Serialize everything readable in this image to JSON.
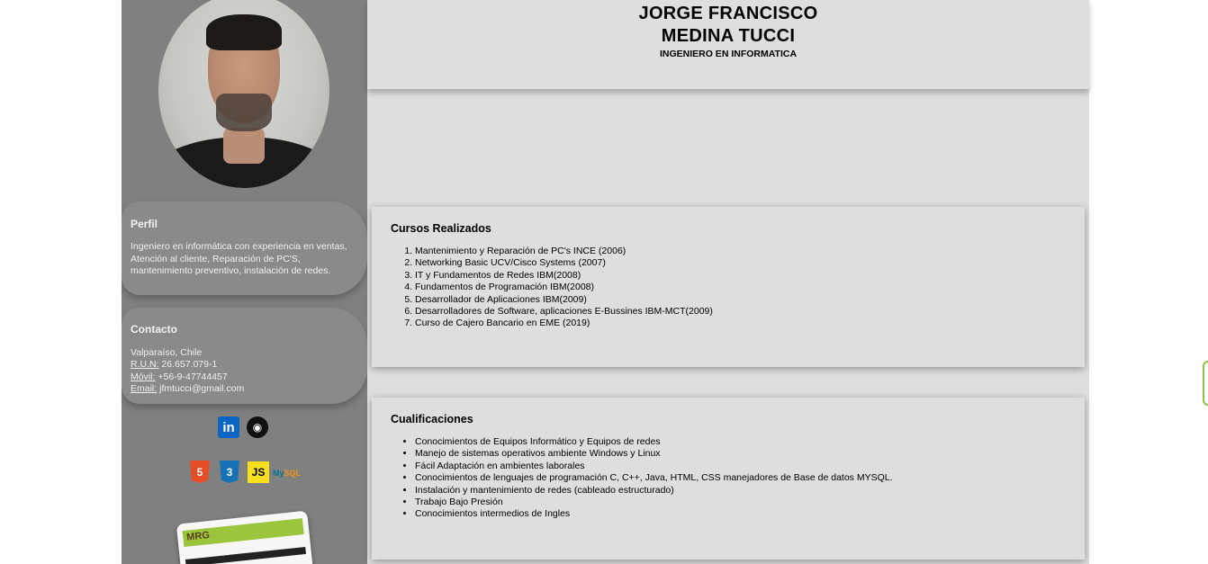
{
  "header": {
    "name_line1": "JORGE FRANCISCO",
    "name_line2": "MEDINA TUCCI",
    "role": "INGENIERO EN INFORMATICA"
  },
  "sidebar": {
    "perfil": {
      "title": "Perfil",
      "text": "Ingeniero en informática con experiencia en ventas, Atención al cliente, Reparación de PC'S, mantenimiento preventivo, instalación de redes."
    },
    "contacto": {
      "title": "Contacto",
      "location": "Valparaíso, Chile",
      "run_label": "R.U.N:",
      "run_value": "26.657.079-1",
      "movil_label": "Móvil:",
      "movil_value": "+56-9-47744457",
      "email_label": "Email:",
      "email_value": "jfmtucci@gmail.com"
    },
    "social": {
      "linkedin_glyph": "in",
      "github_glyph": "◉"
    },
    "tech": {
      "html_glyph": "5",
      "css_glyph": "3",
      "js_glyph": "JS",
      "mysql_my": "My",
      "mysql_sql": "SQL"
    },
    "thumbnail": {
      "logo_text": "MRG"
    }
  },
  "cursos": {
    "title": "Cursos Realizados",
    "items": [
      "Mantenimiento y Reparación de PC's INCE (2006)",
      "Networking Basic UCV/Cisco Systems (2007)",
      "IT y Fundamentos de Redes IBM(2008)",
      "Fundamentos de Programación IBM(2008)",
      "Desarrollador de Aplicaciones IBM(2009)",
      "Desarrolladores de Software, aplicaciones E-Bussines IBM-MCT(2009)",
      "Curso de Cajero Bancario en EME (2019)"
    ]
  },
  "cualificaciones": {
    "title": "Cualificaciones",
    "items": [
      "Conocimientos de Equipos Informático y Equipos de redes",
      "Manejo de sistemas operativos ambiente Windows y Linux",
      "Fácil Adaptación en ambientes laborales",
      "Conocimientos de lenguajes de programación C, C++, Java, HTML, CSS manejadores de Base de datos MYSQL.",
      "Instalación y mantenimiento de redes (cableado estructurado)",
      "Trabajo Bajo Presión",
      "Conocimientos intermedios de Ingles"
    ]
  },
  "colors": {
    "sidebar_bg": "#808080",
    "content_bg": "#dedede",
    "linkedin": "#0a66c2",
    "html5": "#e44d26",
    "css3": "#1572b6",
    "js": "#f7df1e"
  }
}
